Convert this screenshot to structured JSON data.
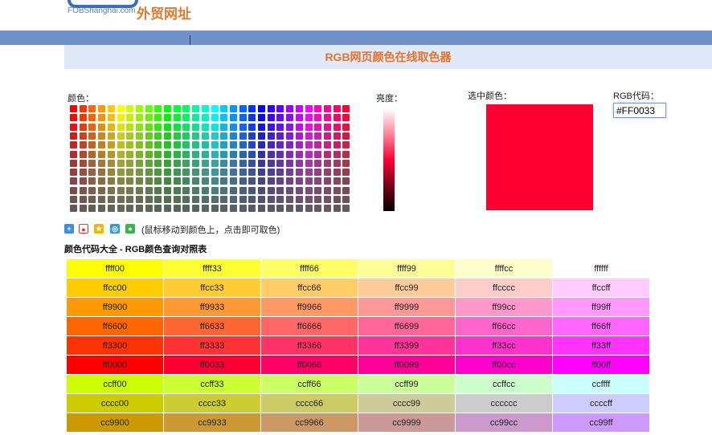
{
  "logo": {
    "text_en": "FOBShanghai.com",
    "text_cn": "外贸网址"
  },
  "title": "RGB网页颜色在线取色器",
  "labels": {
    "color": "颜色：",
    "brightness": "亮度：",
    "selected": "选中颜色：",
    "rgb_code": "RGB代码："
  },
  "rgb_value": "#FF0033",
  "selected_color": "#ff0033",
  "hint": "(鼠标移动到颜色上，点击即可取色)",
  "share_icons": [
    "add-icon",
    "sina-weibo-icon",
    "qzone-icon",
    "tencent-weibo-icon",
    "wechat-icon"
  ],
  "section_title": "颜色代码大全 - RGB颜色查询对照表",
  "color_table": [
    [
      "ffff00",
      "ffff33",
      "ffff66",
      "ffff99",
      "ffffcc",
      "ffffff"
    ],
    [
      "ffcc00",
      "ffcc33",
      "ffcc66",
      "ffcc99",
      "ffcccc",
      "ffccff"
    ],
    [
      "ff9900",
      "ff9933",
      "ff9966",
      "ff9999",
      "ff99cc",
      "ff99ff"
    ],
    [
      "ff6600",
      "ff6633",
      "ff6666",
      "ff6699",
      "ff66cc",
      "ff66ff"
    ],
    [
      "ff3300",
      "ff3333",
      "ff3366",
      "ff3399",
      "ff33cc",
      "ff33ff"
    ],
    [
      "ff0000",
      "ff0033",
      "ff0066",
      "ff0099",
      "ff00cc",
      "ff00ff"
    ],
    [
      "ccff00",
      "ccff33",
      "ccff66",
      "ccff99",
      "ccffcc",
      "ccffff"
    ],
    [
      "cccc00",
      "cccc33",
      "cccc66",
      "cccc99",
      "cccccc",
      "ccccff"
    ],
    [
      "cc9900",
      "cc9933",
      "cc9966",
      "cc9999",
      "cc99cc",
      "cc99ff"
    ]
  ]
}
